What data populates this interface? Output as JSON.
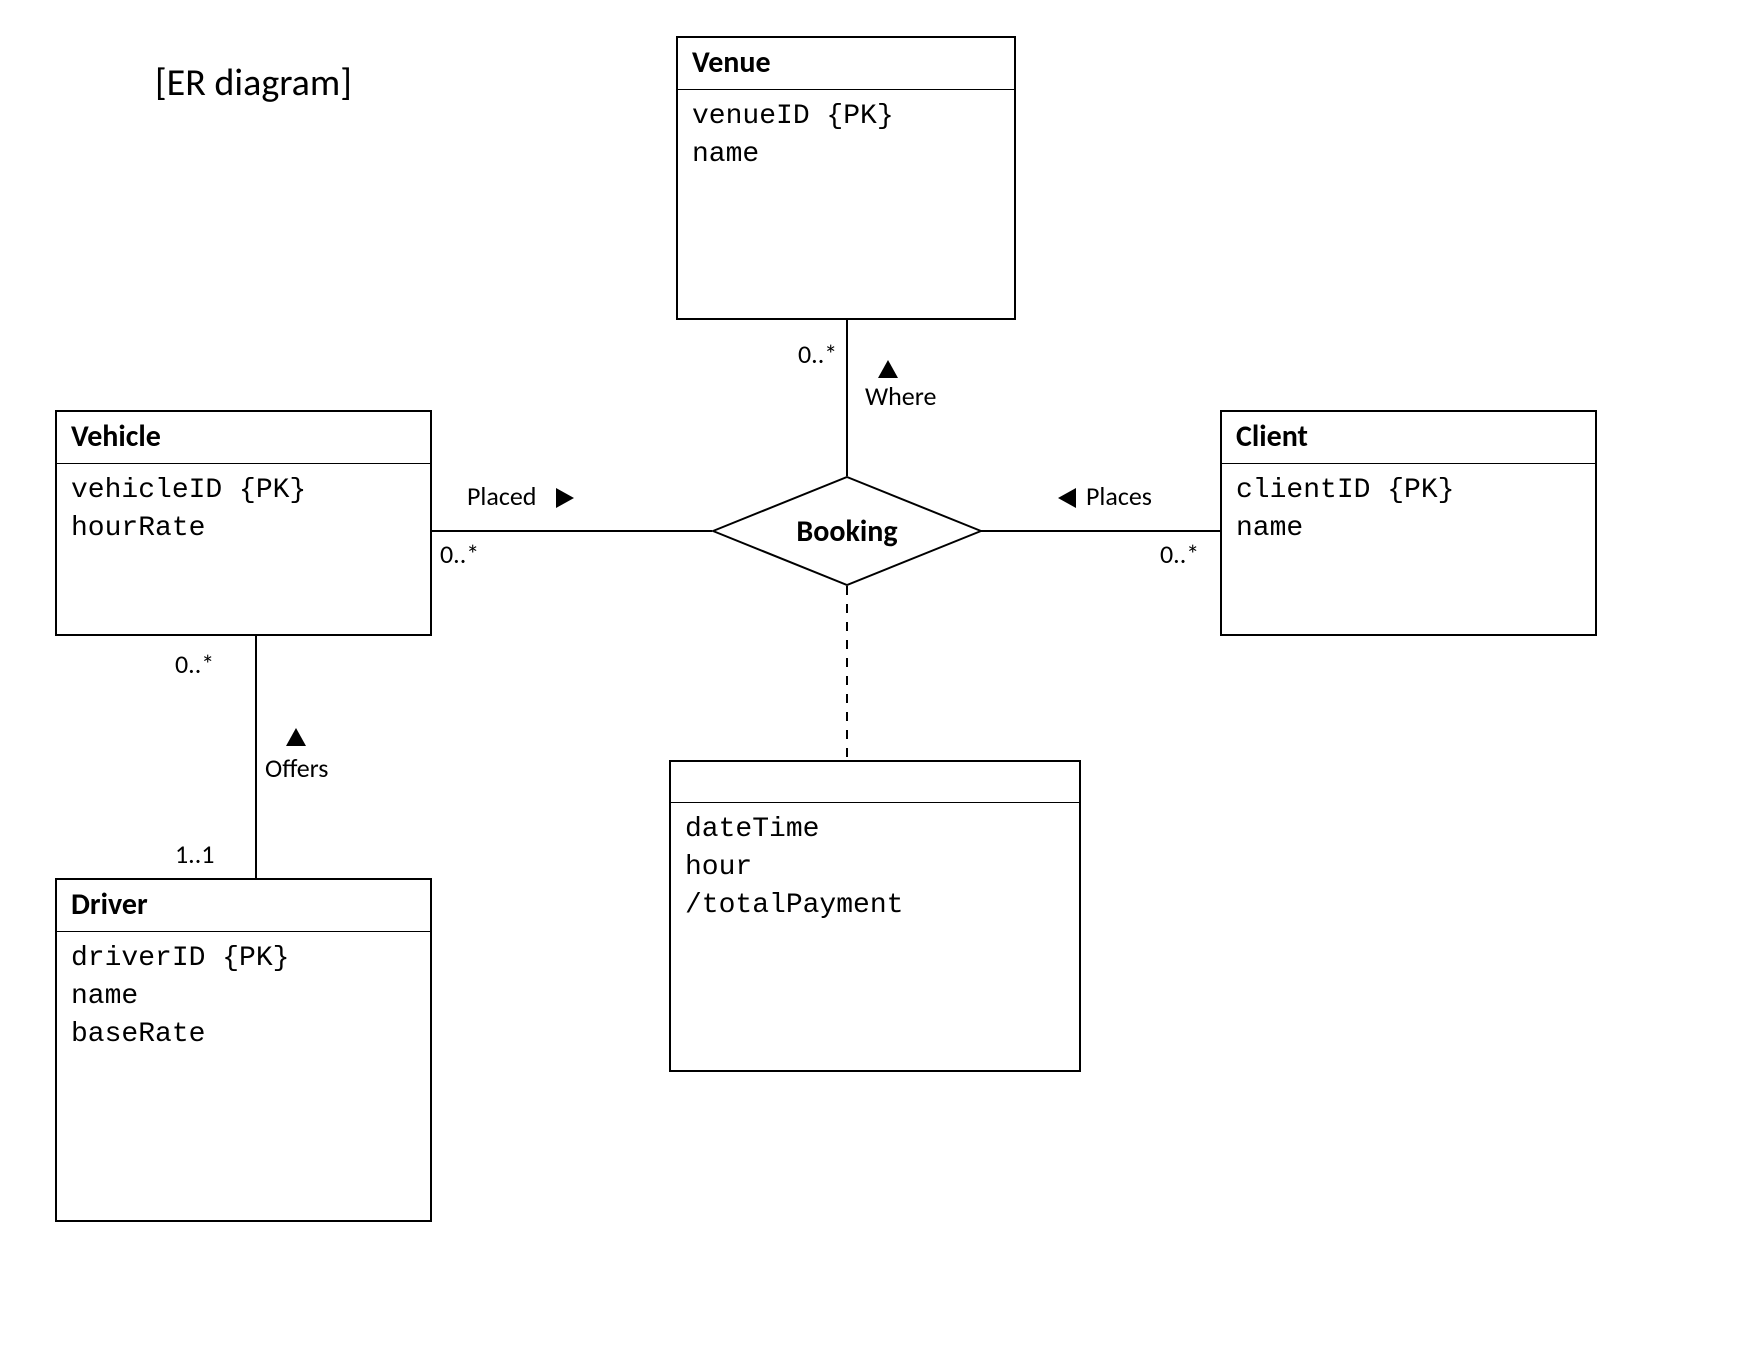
{
  "title": "[ER diagram]",
  "entities": {
    "venue": {
      "name": "Venue",
      "attrs": "venueID {PK}\nname"
    },
    "vehicle": {
      "name": "Vehicle",
      "attrs": "vehicleID {PK}\nhourRate"
    },
    "client": {
      "name": "Client",
      "attrs": "clientID {PK}\nname"
    },
    "driver": {
      "name": "Driver",
      "attrs": "driverID {PK}\nname\nbaseRate"
    },
    "booking_attrs": {
      "name": "",
      "attrs": "dateTime\nhour\n/totalPayment"
    }
  },
  "relationship": {
    "booking": "Booking"
  },
  "associations": {
    "where": {
      "label": "Where",
      "mult": "0..*"
    },
    "placed": {
      "label": "Placed",
      "mult": "0..*"
    },
    "places": {
      "label": "Places",
      "mult": "0..*"
    },
    "offers": {
      "label": "Offers",
      "multTop": "0..*",
      "multBot": "1..1"
    }
  }
}
